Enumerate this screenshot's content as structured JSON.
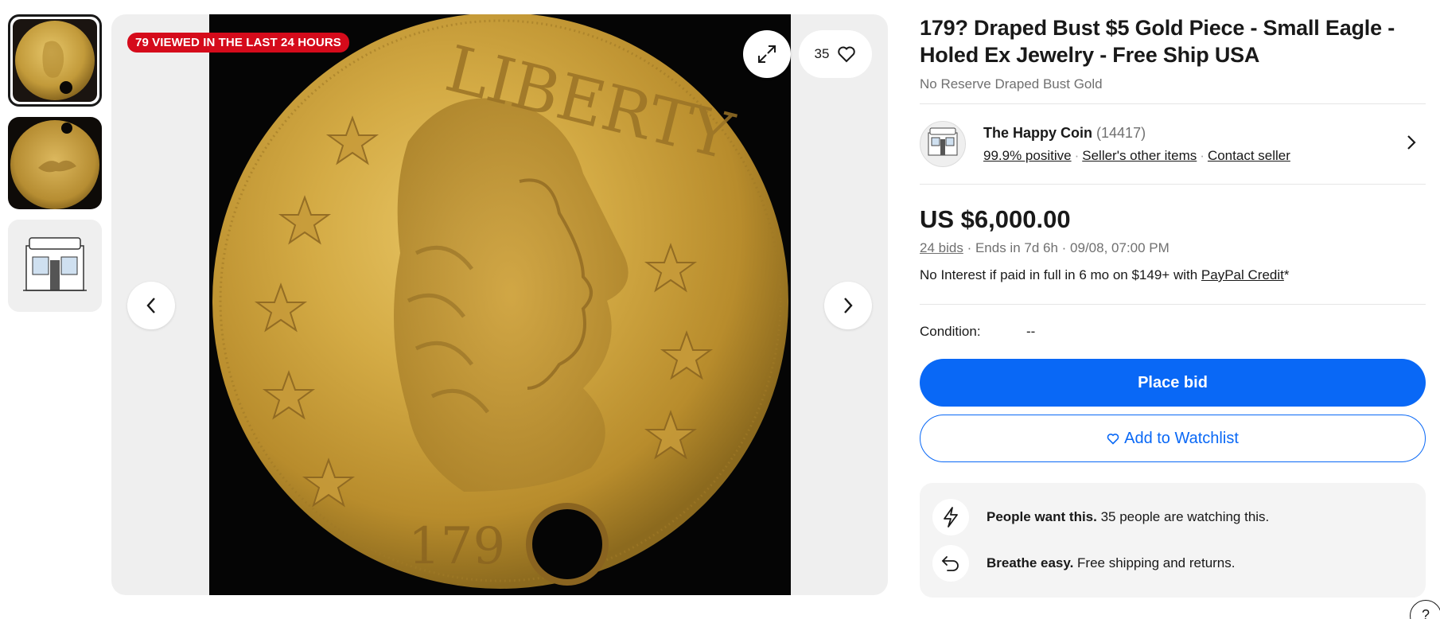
{
  "gallery": {
    "badge": "79 VIEWED IN THE LAST 24 HOURS",
    "watch_count": "35",
    "coin_inscription": "LIBERTY",
    "coin_date_partial": "179"
  },
  "listing": {
    "title": "179? Draped Bust $5 Gold Piece - Small Eagle - Holed Ex Jewelry - Free Ship USA",
    "subtitle": "No Reserve Draped Bust Gold"
  },
  "seller": {
    "name": "The Happy Coin",
    "feedback_count": "(14417)",
    "positive": "99.9% positive",
    "other_items": "Seller's other items",
    "contact": "Contact seller"
  },
  "pricing": {
    "price": "US $6,000.00",
    "bids": "24 bids",
    "ends": "Ends in 7d 6h",
    "end_time": "09/08, 07:00 PM",
    "interest_prefix": "No Interest if paid in full in 6 mo on $149+ with",
    "interest_link": "PayPal Credit",
    "interest_suffix": "*"
  },
  "condition": {
    "label": "Condition:",
    "value": "--"
  },
  "actions": {
    "place_bid": "Place bid",
    "add_watchlist": "Add to Watchlist"
  },
  "info": {
    "row1_bold": "People want this.",
    "row1_text": " 35 people are watching this.",
    "row2_bold": "Breathe easy.",
    "row2_text": " Free shipping and returns."
  },
  "help": {
    "label": "?"
  },
  "colors": {
    "accent": "#0968f6",
    "badge_red": "#d50b1b",
    "coin_gold": "#c9a23a"
  },
  "icons": {
    "expand": "expand-icon",
    "heart": "heart-icon",
    "prev": "chevron-left-icon",
    "next": "chevron-right-icon",
    "lightning": "lightning-icon",
    "return": "return-arrow-icon"
  }
}
